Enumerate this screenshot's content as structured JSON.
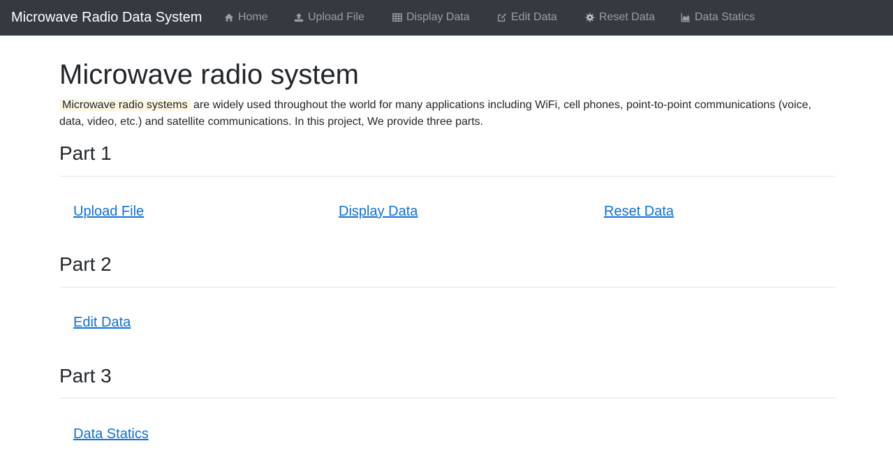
{
  "navbar": {
    "brand": "Microwave Radio Data System",
    "items": [
      {
        "label": "Home",
        "icon": "home-icon"
      },
      {
        "label": "Upload File",
        "icon": "upload-icon"
      },
      {
        "label": "Display Data",
        "icon": "table-icon"
      },
      {
        "label": "Edit Data",
        "icon": "edit-icon"
      },
      {
        "label": "Reset Data",
        "icon": "gear-icon"
      },
      {
        "label": "Data Statics",
        "icon": "area-chart-icon"
      }
    ]
  },
  "main": {
    "title": "Microwave radio system",
    "intro_highlight": "Microwave radio systems",
    "intro_text": " are widely used throughout the world for many applications including WiFi, cell phones, point-to-point communications (voice, data, video, etc.) and satellite communications. In this project, We provide three parts.",
    "parts": [
      {
        "heading": "Part 1",
        "links": [
          "Upload File",
          "Display Data",
          "Reset Data"
        ]
      },
      {
        "heading": "Part 2",
        "links": [
          "Edit Data"
        ]
      },
      {
        "heading": "Part 3",
        "links": [
          "Data Statics"
        ]
      }
    ]
  },
  "colors": {
    "navbar_bg": "#343a40",
    "link": "#0f6fd7",
    "highlight": "#fcf8e3"
  }
}
